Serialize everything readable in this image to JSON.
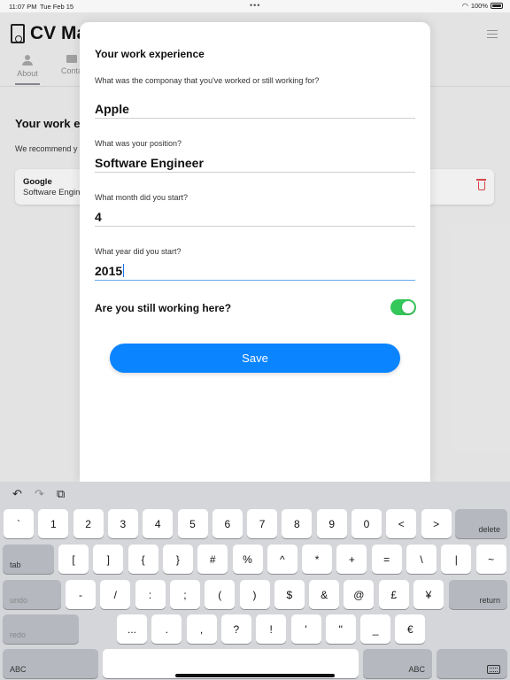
{
  "status_bar": {
    "time": "11:07 PM",
    "date": "Tue Feb 15",
    "battery": "100%"
  },
  "background": {
    "app_title": "CV Ma",
    "tabs": [
      {
        "label": "About"
      },
      {
        "label": "Conta"
      }
    ],
    "heading": "Your work exp",
    "subtitle": "We recommend y",
    "card": {
      "company": "Google",
      "position": "Software Engin"
    }
  },
  "form": {
    "title": "Your work experience",
    "company_question": "What was the componay that you've worked or still working for?",
    "company_value": "Apple",
    "position_question": "What was your position?",
    "position_value": "Software Engineer",
    "month_question": "What month did you start?",
    "month_value": "4",
    "year_question": "What year did you start?",
    "year_value": "2015",
    "still_working_label": "Are you still working here?",
    "still_working": true,
    "save_label": "Save",
    "toggle_color": "#34c759",
    "accent_color": "#0a84ff"
  },
  "keyboard": {
    "toolbar": {
      "undo_icon": "↶",
      "redo_icon": "↷",
      "paste_icon": "⧉"
    },
    "row1": [
      "`",
      "1",
      "2",
      "3",
      "4",
      "5",
      "6",
      "7",
      "8",
      "9",
      "0",
      "<",
      ">"
    ],
    "row1_end": "delete",
    "row2_start": "tab",
    "row2": [
      "[",
      "]",
      "{",
      "}",
      "#",
      "%",
      "^",
      "*",
      "+",
      "=",
      "\\",
      "|",
      "~"
    ],
    "row3_start": "undo",
    "row3": [
      "-",
      "/",
      ":",
      ";",
      "(",
      ")",
      "$",
      "&",
      "@",
      "£",
      "¥"
    ],
    "row3_end": "return",
    "row4_start": "redo",
    "row4": [
      "...",
      ".",
      ",",
      "?",
      "!",
      "'",
      "\"",
      "_",
      "€"
    ],
    "row5_left": "ABC",
    "row5_right": "ABC"
  }
}
